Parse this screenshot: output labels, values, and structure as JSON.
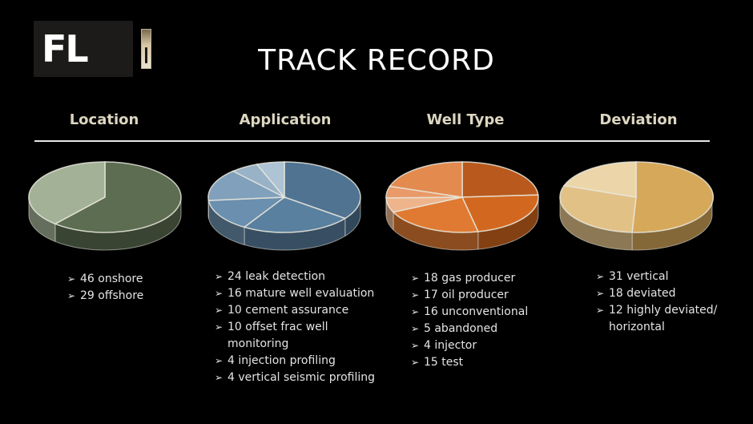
{
  "logo": {
    "text": "FL",
    "icon": "fiber-optic-cable-icon"
  },
  "title": "TRACK RECORD",
  "bullet_icon": "➢",
  "chart_data": [
    {
      "type": "pie",
      "title": "Location",
      "style": "3d",
      "categories": [
        "onshore",
        "offshore"
      ],
      "values": [
        46,
        29
      ],
      "colors": [
        "#5c6d51",
        "#a3b296"
      ]
    },
    {
      "type": "pie",
      "title": "Application",
      "style": "3d",
      "categories": [
        "leak detection",
        "mature well evaluation",
        "cement assurance",
        "offset frac well monitoring",
        "injection profiling",
        "vertical seismic profiling"
      ],
      "values": [
        24,
        16,
        10,
        10,
        4,
        4
      ],
      "colors": [
        "#4f7391",
        "#5a80a0",
        "#6b8fae",
        "#80a0bb",
        "#98b2c8",
        "#aec3d4"
      ]
    },
    {
      "type": "pie",
      "title": "Well Type",
      "style": "3d",
      "categories": [
        "gas producer",
        "oil producer",
        "unconventional",
        "abandoned",
        "injector",
        "test"
      ],
      "values": [
        18,
        17,
        16,
        5,
        4,
        15
      ],
      "colors": [
        "#b9591d",
        "#d2681f",
        "#e07a32",
        "#eeb48c",
        "#e99a68",
        "#e38a4f"
      ]
    },
    {
      "type": "pie",
      "title": "Deviation",
      "style": "3d",
      "categories": [
        "vertical",
        "deviated",
        "highly deviated/ horizontal"
      ],
      "values": [
        31,
        18,
        12
      ],
      "colors": [
        "#d6a85a",
        "#e2c187",
        "#ecd6a9"
      ]
    }
  ],
  "columns": [
    {
      "heading": "Location",
      "items": [
        "46 onshore",
        "29 offshore"
      ]
    },
    {
      "heading": "Application",
      "items": [
        "24 leak detection",
        "16 mature well evaluation",
        "10 cement assurance",
        "10 offset frac well monitoring",
        "4 injection profiling",
        "4 vertical seismic profiling"
      ]
    },
    {
      "heading": "Well Type",
      "items": [
        "18 gas producer",
        "17 oil producer",
        "16 unconventional",
        "5 abandoned",
        "4 injector",
        "15 test"
      ]
    },
    {
      "heading": "Deviation",
      "items": [
        "31 vertical",
        "18 deviated",
        "12 highly deviated/ horizontal"
      ]
    }
  ]
}
